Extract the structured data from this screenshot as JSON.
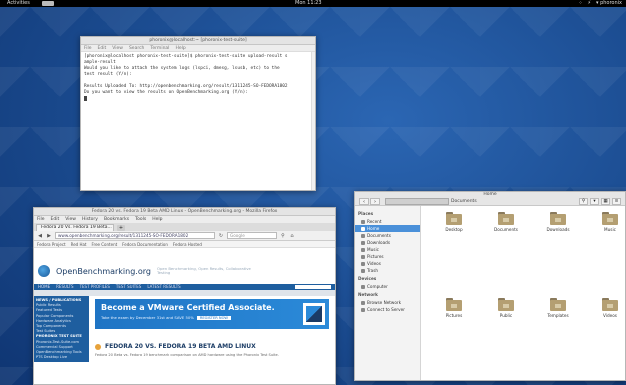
{
  "topbar": {
    "activities": "Activities",
    "clock": "Mon 11:23",
    "tray": [
      "⁘",
      "⚡",
      "▾ phoronix"
    ]
  },
  "terminal": {
    "title": "phoronix@localhost:~ [phoronix-test-suite]",
    "menu": [
      "File",
      "Edit",
      "View",
      "Search",
      "Terminal",
      "Help"
    ],
    "lines": [
      "[phoronix@localhost phoronix-test-suite]$ phoronix-test-suite upload-result s",
      "ample-result",
      "    Would you like to attach the system logs (lspci, dmesg, lsusb, etc) to the",
      " test result (Y/n):",
      "",
      "Results Uploaded To: http://openbenchmarking.org/result/1311245-SO-FEDORA1802",
      "    Do you want to view the results on OpenBenchmarking.org (Y/n):"
    ]
  },
  "browser": {
    "title": "Fedora 20 vs. Fedora 19 Beta AMD Linux - OpenBenchmarking.org - Mozilla Firefox",
    "menu": [
      "File",
      "Edit",
      "View",
      "History",
      "Bookmarks",
      "Tools",
      "Help"
    ],
    "tab": "Fedora 20 Vs. Fedora 19 Beta...",
    "url": "www.openbenchmarking.org/result/1311245-SO-FEDORA1802",
    "search_placeholder": "Google",
    "bookmarks": [
      "Fedora Project",
      "Red Hat",
      "Free Content",
      "Fedora Documentation",
      "Fedora Hosted"
    ],
    "site": {
      "name": "OpenBenchmarking.org",
      "tagline": "Open Benchmarking, Open Results, Collaborative Testing",
      "nav": [
        "HOME",
        "RESULTS",
        "TEST PROFILES",
        "TEST SUITES",
        "LATEST RESULTS"
      ],
      "side": [
        {
          "t": "NEWS / PUBLICATIONS",
          "hd": true
        },
        {
          "t": "Public Results",
          "hd": false
        },
        {
          "t": "Featured Tests",
          "hd": false
        },
        {
          "t": "Popular Components",
          "hd": false
        },
        {
          "t": "Hardware Analytics",
          "hd": false
        },
        {
          "t": "Top Components",
          "hd": false
        },
        {
          "t": "Test Suites",
          "hd": false
        },
        {
          "t": "PHORONIX TEST SUITE",
          "hd": true
        },
        {
          "t": "Phoronix-Test-Suite.com",
          "hd": false
        },
        {
          "t": "Commercial Support",
          "hd": false
        },
        {
          "t": "OpenBenchmarking Tools",
          "hd": false
        },
        {
          "t": "PTS Desktop Live",
          "hd": false
        }
      ],
      "banner_title": "Become a VMware Certified Associate.",
      "banner_sub": "Take the exam by December 31st and SAVE 50%",
      "banner_btn": "REGISTER NOW",
      "headline": "FEDORA 20 VS. FEDORA 19 BETA AMD LINUX",
      "body": "Fedora 20 Beta vs. Fedora 19 benchmark comparison on AMD hardware using the Phoronix Test Suite."
    }
  },
  "files": {
    "title": "Home",
    "crumb": "Documents",
    "sidebar": {
      "places_label": "Places",
      "places": [
        {
          "label": "Recent",
          "sel": false
        },
        {
          "label": "Home",
          "sel": true
        },
        {
          "label": "Documents",
          "sel": false
        },
        {
          "label": "Downloads",
          "sel": false
        },
        {
          "label": "Music",
          "sel": false
        },
        {
          "label": "Pictures",
          "sel": false
        },
        {
          "label": "Videos",
          "sel": false
        },
        {
          "label": "Trash",
          "sel": false
        }
      ],
      "devices_label": "Devices",
      "devices": [
        {
          "label": "Computer",
          "sel": false
        }
      ],
      "network_label": "Network",
      "network": [
        {
          "label": "Browse Network",
          "sel": false
        },
        {
          "label": "Connect to Server",
          "sel": false
        }
      ]
    },
    "items": [
      "Desktop",
      "Documents",
      "Downloads",
      "Music",
      "Pictures",
      "Public",
      "Templates",
      "Videos"
    ]
  }
}
